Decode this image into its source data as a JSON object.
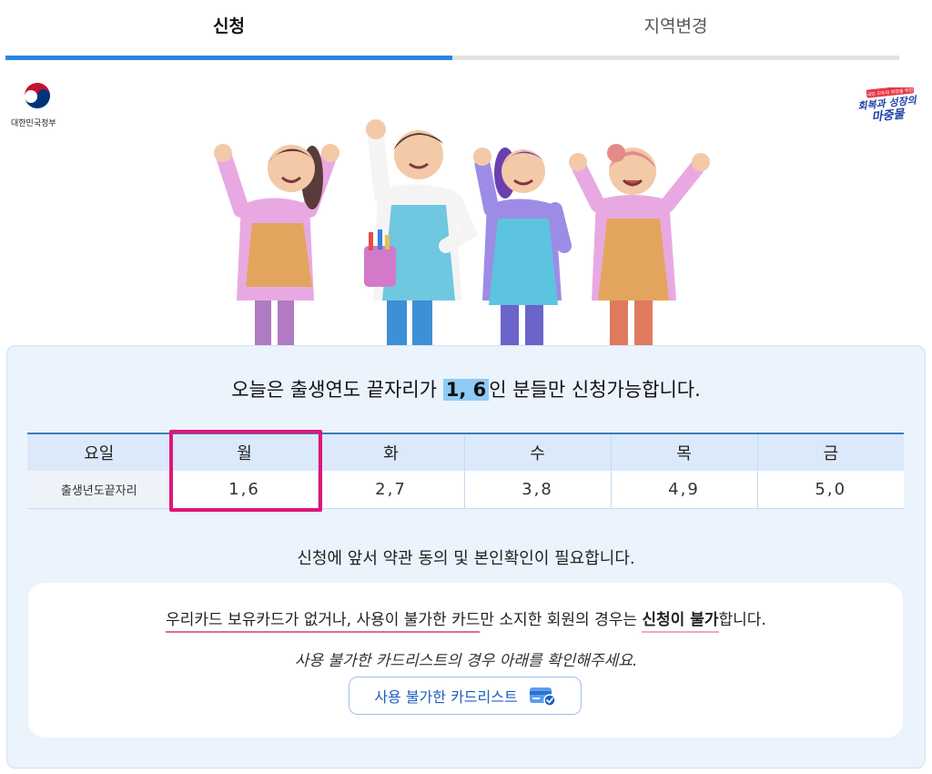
{
  "tabs": [
    {
      "label": "신청",
      "active": true
    },
    {
      "label": "지역변경",
      "active": false
    }
  ],
  "logos": {
    "gov_text": "대한민국정부",
    "campaign_small": "국민 모두의 희망을 위한",
    "campaign_line1": "회복과 성장의",
    "campaign_line2": "마중물"
  },
  "headline": {
    "prefix": "오늘은 출생연도 끝자리가 ",
    "digits": "1, 6",
    "suffix": "인 분들만 신청가능합니다."
  },
  "schedule": {
    "header_label": "요일",
    "row_label": "출생년도끝자리",
    "days": [
      {
        "day": "월",
        "digits": "1,6",
        "today": true
      },
      {
        "day": "화",
        "digits": "2,7",
        "today": false
      },
      {
        "day": "수",
        "digits": "3,8",
        "today": false
      },
      {
        "day": "목",
        "digits": "4,9",
        "today": false
      },
      {
        "day": "금",
        "digits": "5,0",
        "today": false
      }
    ]
  },
  "notice": "신청에 앞서 약관 동의 및 본인확인이 필요합니다.",
  "warning": {
    "part1": "우리카드 보유카드가 없거나, 사용이 불가한 카드",
    "part2": "만 소지한 회원의 경우는 ",
    "part3": "신청이 불가",
    "part4": "합니다."
  },
  "hint": "사용 불가한 카드리스트의 경우 아래를 확인해주세요.",
  "list_button": {
    "label": "사용 불가한 카드리스트",
    "icon": "credit-card-check-icon"
  },
  "colors": {
    "accent": "#2a86e0",
    "highlight": "#8fcbf5",
    "today_border": "#e0157a",
    "panel_bg": "#ebf3fc"
  }
}
